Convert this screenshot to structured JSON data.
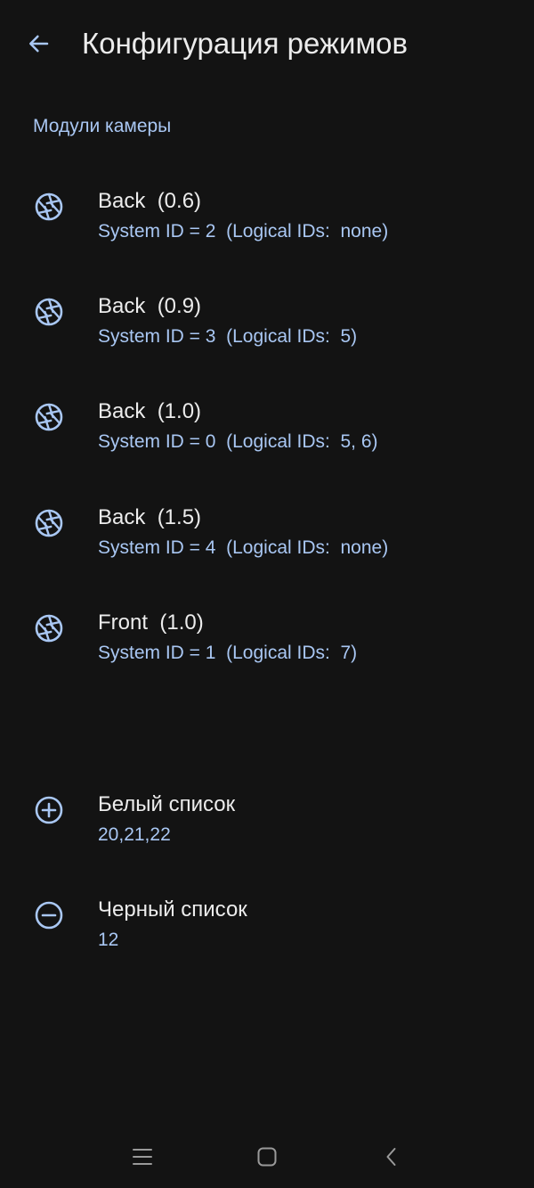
{
  "app_bar": {
    "title": "Конфигурация режимов"
  },
  "section": {
    "header": "Модули камеры"
  },
  "camera_modules": [
    {
      "name": "Back  (0.6)",
      "detail": "System ID = 2  (Logical IDs:  none)"
    },
    {
      "name": "Back  (0.9)",
      "detail": "System ID = 3  (Logical IDs:  5)"
    },
    {
      "name": "Back  (1.0)",
      "detail": "System ID = 0  (Logical IDs:  5, 6)"
    },
    {
      "name": "Back  (1.5)",
      "detail": "System ID = 4  (Logical IDs:  none)"
    },
    {
      "name": "Front  (1.0)",
      "detail": "System ID = 1  (Logical IDs:  7)"
    }
  ],
  "lists": {
    "whitelist": {
      "label": "Белый список",
      "value": "20,21,22"
    },
    "blacklist": {
      "label": "Черный список",
      "value": "12"
    }
  },
  "colors": {
    "background": "#131313",
    "accent": "#a9c7f3",
    "text_primary": "#ececec"
  },
  "icons": {
    "back": "arrow-left-icon",
    "camera": "camera-shutter-icon",
    "whitelist": "plus-circle-icon",
    "blacklist": "minus-circle-icon",
    "nav_menu": "menu-icon",
    "nav_home": "home-icon",
    "nav_back": "chevron-left-icon"
  }
}
